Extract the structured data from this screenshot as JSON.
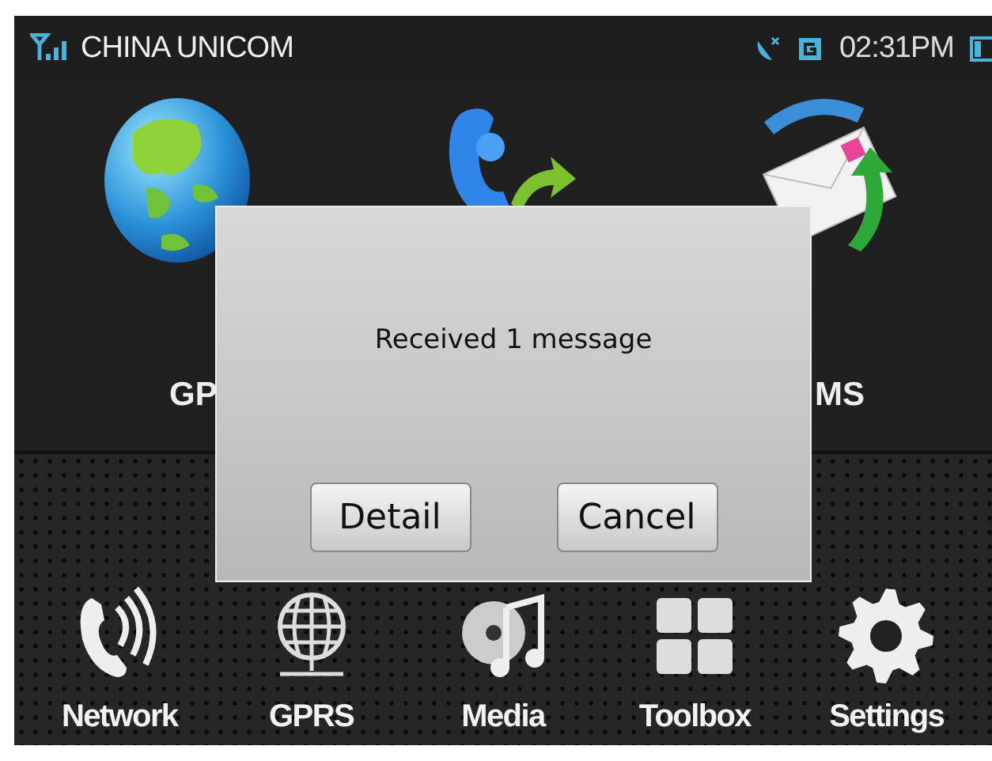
{
  "status_bar": {
    "carrier": "CHINA UNICOM",
    "time": "02:31PM"
  },
  "apps": [
    {
      "kind": "globe",
      "label": "GP"
    },
    {
      "kind": "phone"
    },
    {
      "kind": "mail",
      "label": "MS"
    }
  ],
  "dialog": {
    "message": "Received 1 message",
    "buttons": [
      "Detail",
      "Cancel"
    ]
  },
  "dock": [
    {
      "kind": "call",
      "label": "Network"
    },
    {
      "kind": "grid-globe",
      "label": "GPRS"
    },
    {
      "kind": "music",
      "label": "Media"
    },
    {
      "kind": "tiles",
      "label": "Toolbox"
    },
    {
      "kind": "gear",
      "label": "Settings"
    }
  ]
}
